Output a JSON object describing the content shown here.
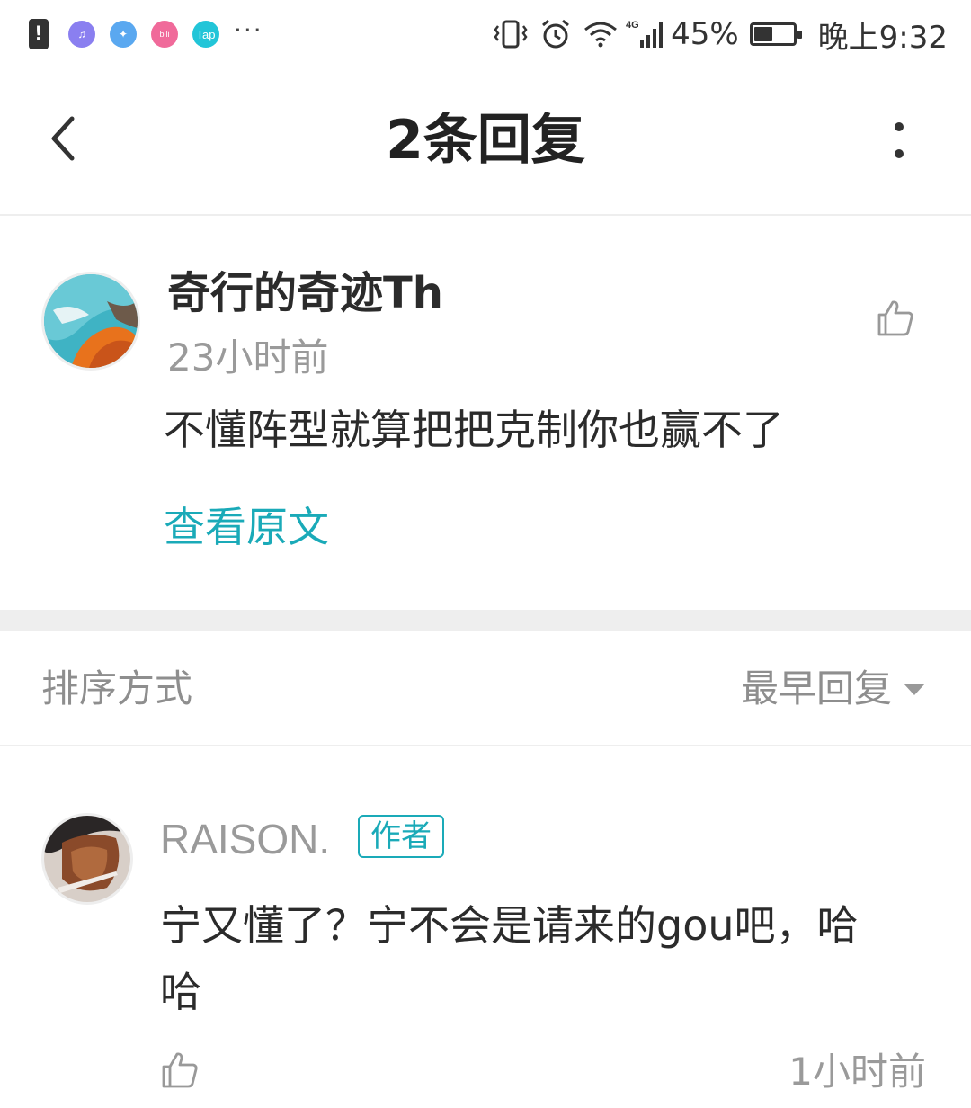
{
  "status_bar": {
    "apps": [
      {
        "icon": "music-app-icon",
        "color": "#8a7ff0",
        "label": "♫"
      },
      {
        "icon": "browser-app-icon",
        "color": "#5aa8f0",
        "label": "✦"
      },
      {
        "icon": "bilibili-app-icon",
        "color": "#f06a9a",
        "label": "bilibili"
      },
      {
        "icon": "taptap-app-icon",
        "color": "#22c5d8",
        "label": "Tap"
      }
    ],
    "overflow": "···",
    "network": "4G",
    "battery_percent": "45%",
    "battery_level": 0.45,
    "time": "晚上9:32"
  },
  "header": {
    "title": "2条回复"
  },
  "original_comment": {
    "user_name": "奇行的奇迹Th",
    "time": "23小时前",
    "text": "不懂阵型就算把把克制你也赢不了",
    "view_original_label": "查看原文"
  },
  "sort": {
    "label": "排序方式",
    "selected": "最早回复"
  },
  "reply": {
    "user_name": "RAISON.",
    "badge": "作者",
    "text": "宁又懂了？宁不会是请来的gou吧，哈哈",
    "time": "1小时前"
  },
  "colors": {
    "accent": "#1aaab8",
    "divider": "#eeeeee",
    "muted_text": "#9a9a9a"
  }
}
